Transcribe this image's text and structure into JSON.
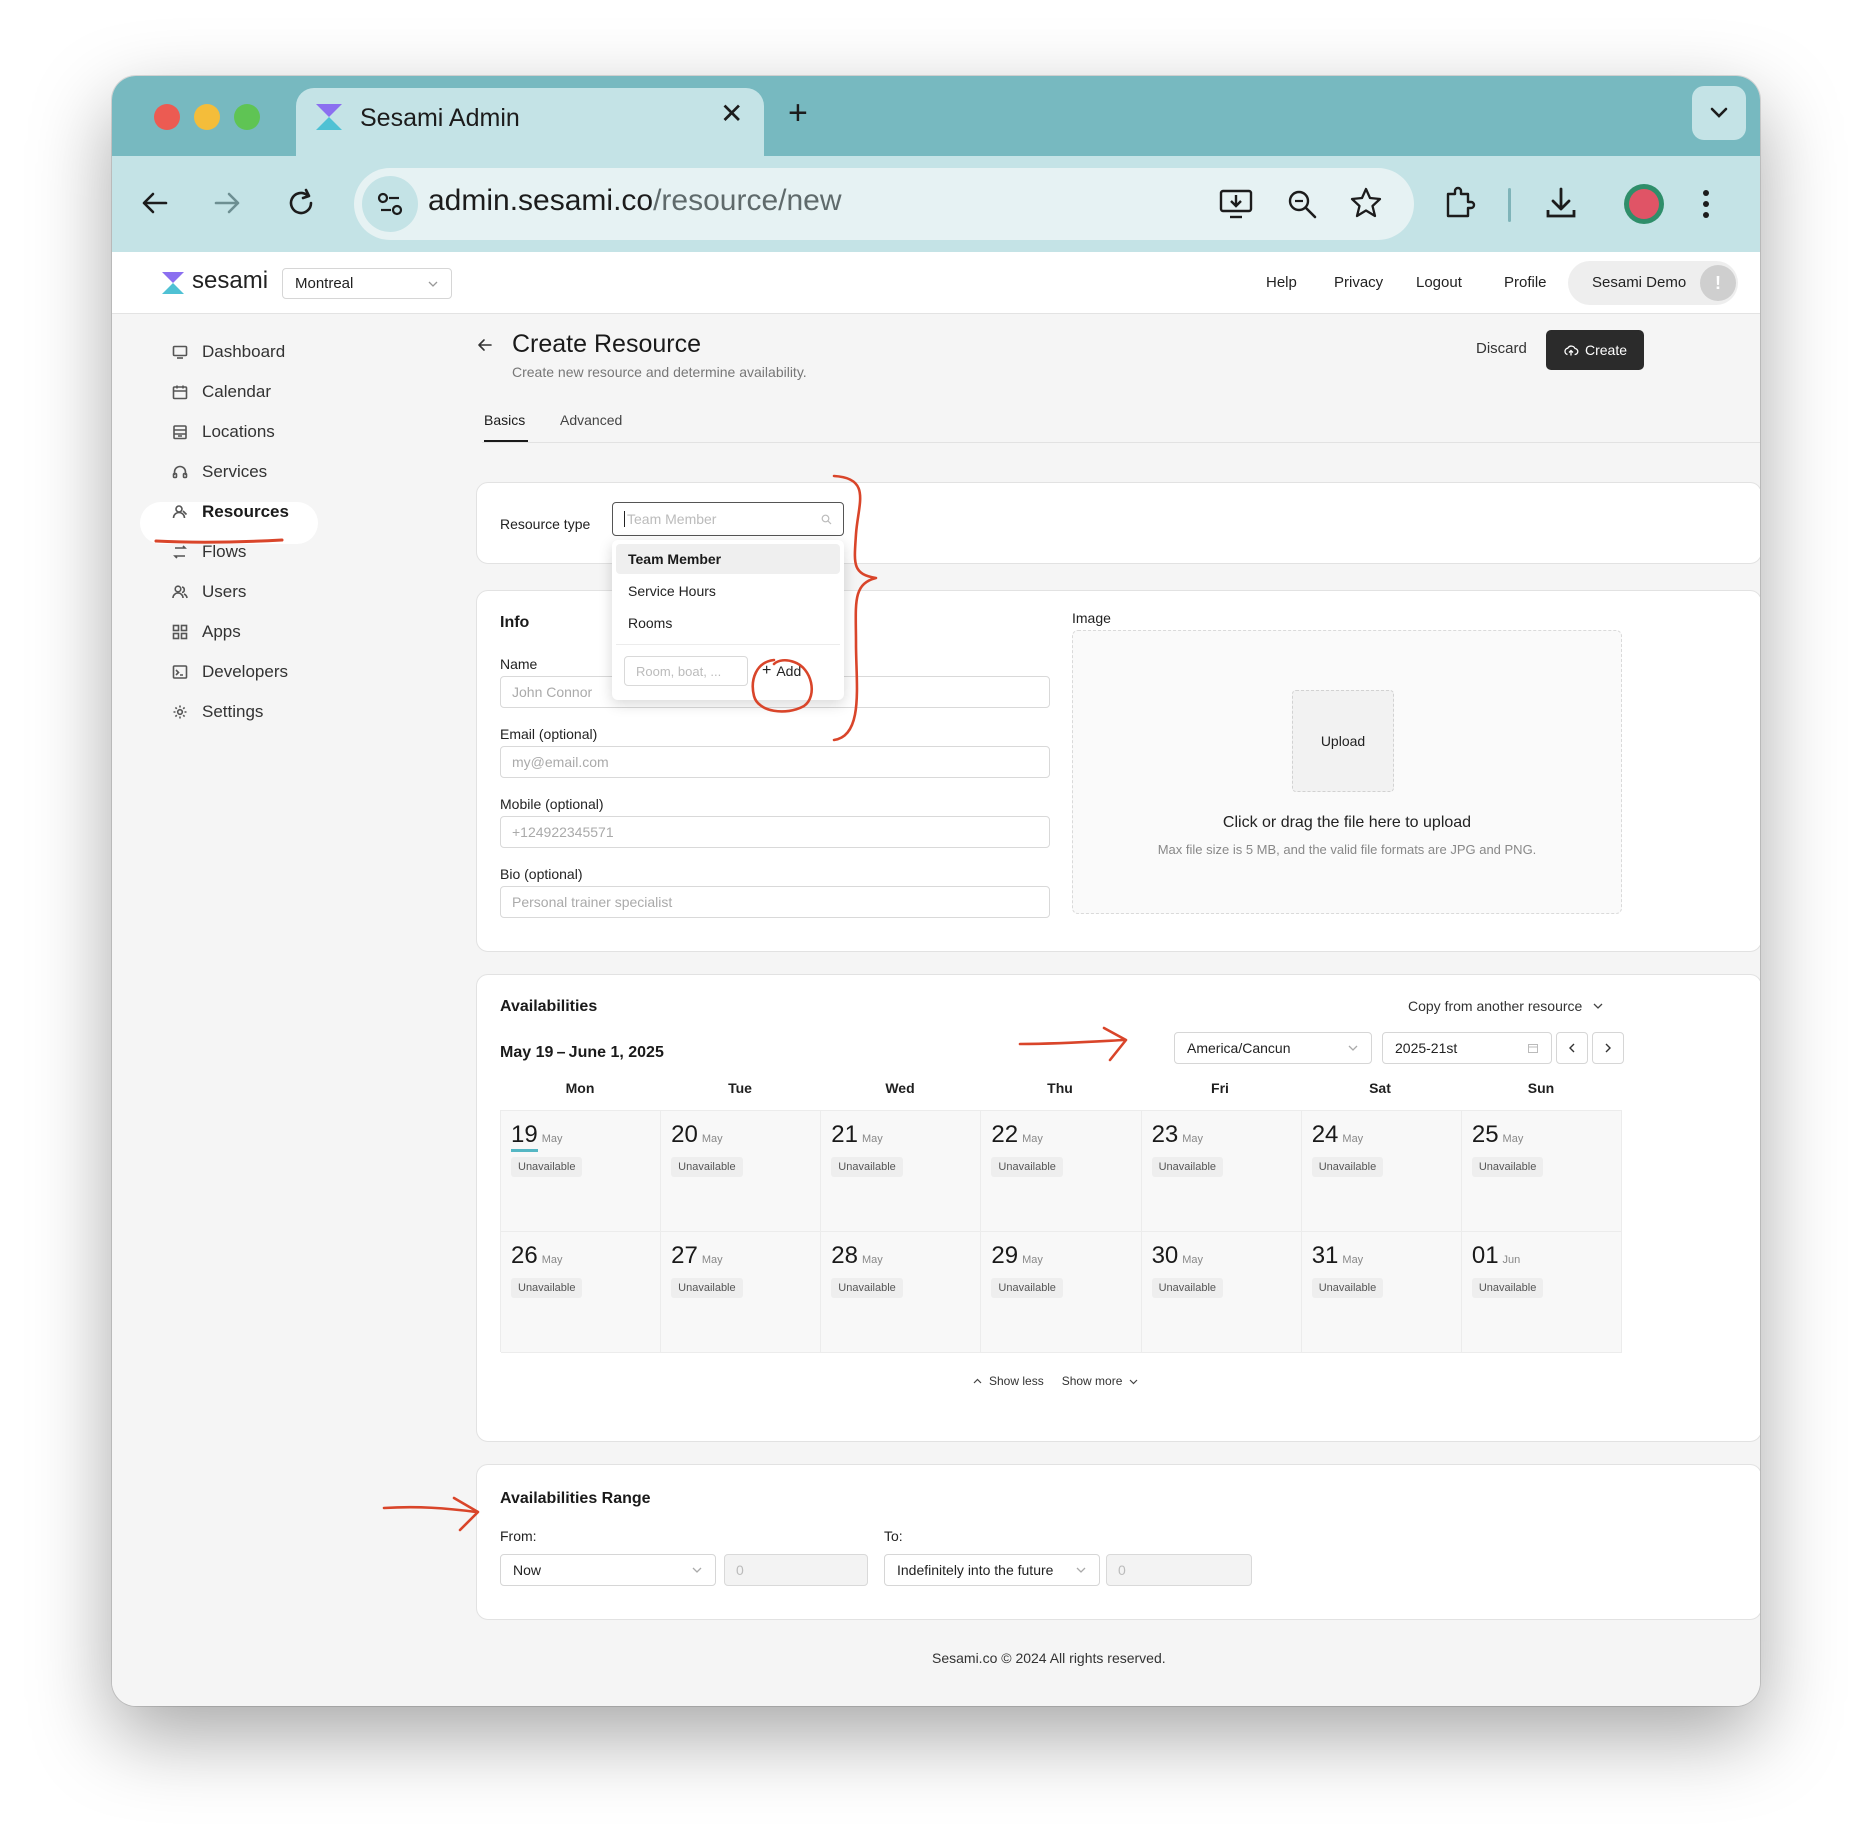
{
  "browser": {
    "tab_title": "Sesami Admin",
    "url_host": "admin.sesami.co",
    "url_path": "/resource/new"
  },
  "app": {
    "brand": "sesami",
    "location_select": "Montreal",
    "nav": [
      "Help",
      "Privacy",
      "Logout",
      "Profile"
    ],
    "user": "Sesami Demo"
  },
  "sidebar": {
    "items": [
      {
        "label": "Dashboard",
        "icon": "monitor-icon"
      },
      {
        "label": "Calendar",
        "icon": "calendar-icon"
      },
      {
        "label": "Locations",
        "icon": "building-icon"
      },
      {
        "label": "Services",
        "icon": "headset-icon"
      },
      {
        "label": "Resources",
        "icon": "person-icon",
        "active": true
      },
      {
        "label": "Flows",
        "icon": "flow-icon"
      },
      {
        "label": "Users",
        "icon": "users-icon"
      },
      {
        "label": "Apps",
        "icon": "apps-icon"
      },
      {
        "label": "Developers",
        "icon": "terminal-icon"
      },
      {
        "label": "Settings",
        "icon": "gear-icon"
      }
    ]
  },
  "page": {
    "title": "Create Resource",
    "subtitle": "Create new resource and determine availability.",
    "discard": "Discard",
    "create": "Create",
    "tabs": [
      "Basics",
      "Advanced"
    ]
  },
  "resource_type": {
    "label": "Resource type",
    "placeholder": "Team Member",
    "options": [
      "Team Member",
      "Service Hours",
      "Rooms"
    ],
    "add_placeholder": "Room, boat, ...",
    "add_label": "Add"
  },
  "info": {
    "title": "Info",
    "name_label": "Name",
    "name_placeholder": "John Connor",
    "email_label": "Email (optional)",
    "email_placeholder": "my@email.com",
    "mobile_label": "Mobile (optional)",
    "mobile_placeholder": "+124922345571",
    "bio_label": "Bio (optional)",
    "bio_placeholder": "Personal trainer specialist"
  },
  "image": {
    "label": "Image",
    "upload": "Upload",
    "hint": "Click or drag the file here to upload",
    "subhint": "Max file size is 5 MB, and the valid file formats are JPG and PNG."
  },
  "availabilities": {
    "title": "Availabilities",
    "copy": "Copy from another resource",
    "range_label": "May 19 – June 1, 2025",
    "timezone": "America/Cancun",
    "week": "2025-21st",
    "weekdays": [
      "Mon",
      "Tue",
      "Wed",
      "Thu",
      "Fri",
      "Sat",
      "Sun"
    ],
    "status": "Unavailable",
    "days": [
      {
        "n": "19",
        "m": "May"
      },
      {
        "n": "20",
        "m": "May"
      },
      {
        "n": "21",
        "m": "May"
      },
      {
        "n": "22",
        "m": "May"
      },
      {
        "n": "23",
        "m": "May"
      },
      {
        "n": "24",
        "m": "May"
      },
      {
        "n": "25",
        "m": "May"
      },
      {
        "n": "26",
        "m": "May"
      },
      {
        "n": "27",
        "m": "May"
      },
      {
        "n": "28",
        "m": "May"
      },
      {
        "n": "29",
        "m": "May"
      },
      {
        "n": "30",
        "m": "May"
      },
      {
        "n": "31",
        "m": "May"
      },
      {
        "n": "01",
        "m": "Jun"
      }
    ],
    "show_less": "Show less",
    "show_more": "Show more"
  },
  "range": {
    "title": "Availabilities Range",
    "from_label": "From:",
    "from_value": "Now",
    "from_number": "0",
    "to_label": "To:",
    "to_value": "Indefinitely into the future",
    "to_number": "0"
  },
  "footer": "Sesami.co © 2024  All rights reserved.",
  "colors": {
    "accent": "#77b9c0",
    "annotation": "#d9452a",
    "primary_button": "#2b2b2b"
  }
}
